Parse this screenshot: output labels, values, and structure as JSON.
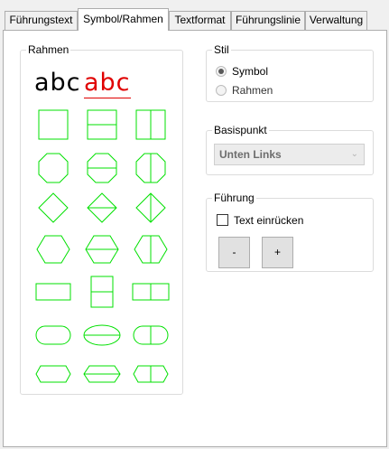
{
  "tabs": [
    {
      "label": "Führungstext"
    },
    {
      "label": "Symbol/Rahmen"
    },
    {
      "label": "Textformat"
    },
    {
      "label": "Führungslinie"
    },
    {
      "label": "Verwaltung"
    }
  ],
  "rahmen": {
    "title": "Rahmen",
    "sample_plain": "abc",
    "sample_underlined": "abc",
    "colors": {
      "shape": "#00e000",
      "sample_red": "#e00000"
    }
  },
  "stil": {
    "title": "Stil",
    "options": [
      {
        "label": "Symbol",
        "checked": true
      },
      {
        "label": "Rahmen",
        "checked": false
      }
    ]
  },
  "basispunkt": {
    "title": "Basispunkt",
    "selected": "Unten Links"
  },
  "fuehrung": {
    "title": "Führung",
    "checkbox_label": "Text einrücken",
    "checked": false,
    "minus_label": "-",
    "plus_label": "+"
  }
}
